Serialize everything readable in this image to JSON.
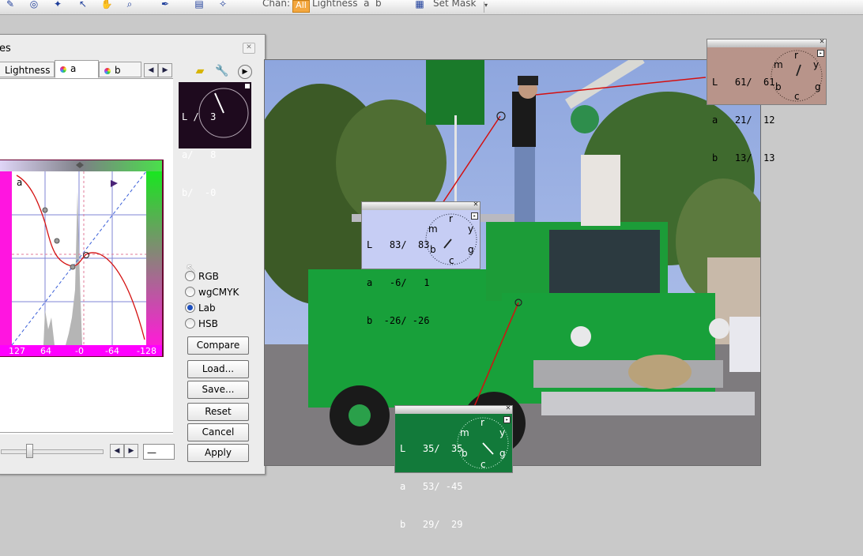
{
  "toolbar": {
    "chan_label": "Chan:",
    "chan_all": "All",
    "chan_options": "Lightness  a  b",
    "set_mask_label": "Set Mask"
  },
  "dialog": {
    "title": "es",
    "tabs": [
      {
        "label": "Lightness"
      },
      {
        "label": "a"
      },
      {
        "label": "b"
      }
    ],
    "curve_channel_label": "a",
    "x_ticks": [
      "127",
      "64",
      "-0",
      "-64",
      "-128"
    ],
    "mini_readout": {
      "rows": [
        "L /  3",
        "a/   8",
        "b/  -0"
      ]
    },
    "color_modes": [
      "RGB",
      "wgCMYK",
      "Lab",
      "HSB"
    ],
    "selected_mode": "Lab",
    "buttons": {
      "compare": "Compare",
      "load": "Load...",
      "save": "Save...",
      "reset": "Reset",
      "cancel": "Cancel",
      "apply": "Apply"
    },
    "value_field": "—"
  },
  "readouts": {
    "top": {
      "rows": [
        "L   61/  61",
        "a   21/  12",
        "b   13/  13"
      ],
      "bg": "#b8948a"
    },
    "middle": {
      "rows": [
        "L   83/  83",
        "a   -6/   1",
        "b  -26/ -26"
      ],
      "bg": "#c6cdf4"
    },
    "bottom": {
      "rows": [
        "L   35/  35",
        "a   53/ -45",
        "b   29/  29"
      ],
      "bg": "#127a3a"
    },
    "dial_letters": [
      "r",
      "y",
      "g",
      "c",
      "b",
      "m"
    ]
  },
  "colors": {
    "curve_red": "#d41010",
    "dialog_bg": "#ececec",
    "accent_orange": "#f3a73f",
    "radio_dot": "#1d4fbe"
  },
  "icons": {
    "toolbar": [
      "hand-icon",
      "zoom-icon",
      "eyedropper-icon",
      "settings-icon"
    ],
    "tabs_row": [
      "layer-icon",
      "wrench-icon",
      "play-icon"
    ]
  }
}
